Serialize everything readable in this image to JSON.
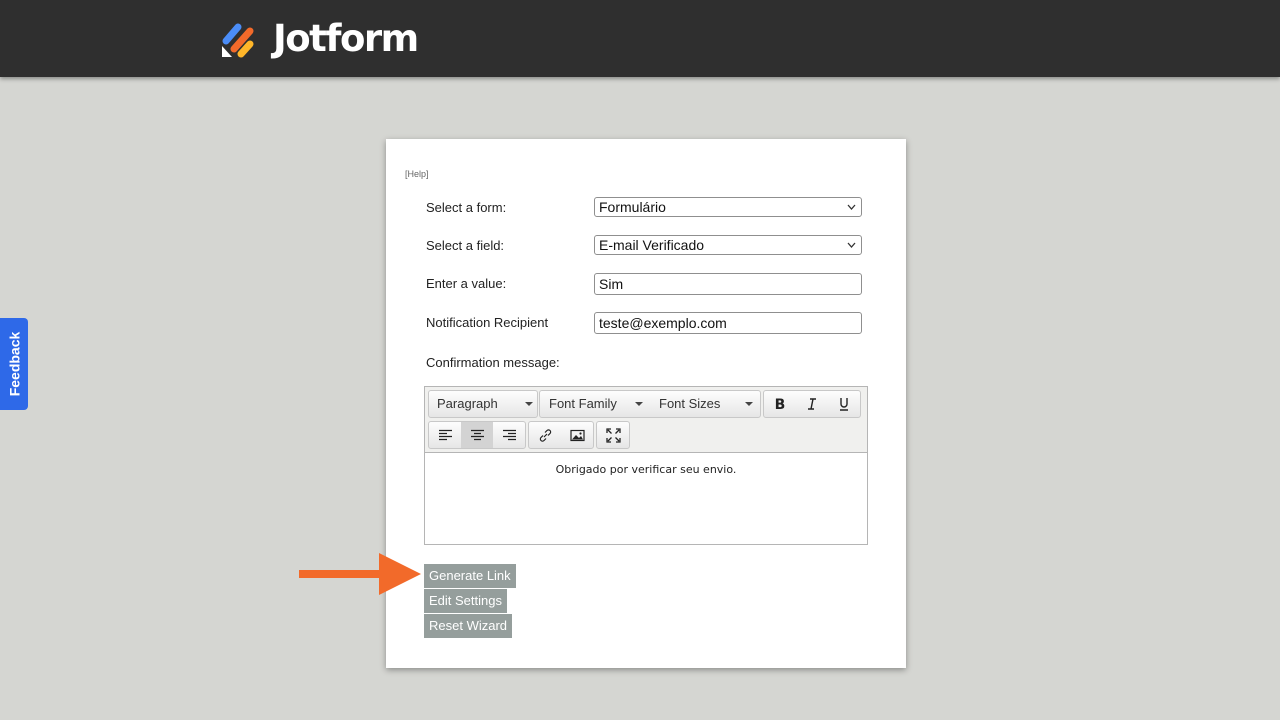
{
  "brand": {
    "name": "Jotform"
  },
  "feedback": {
    "label": "Feedback"
  },
  "panel": {
    "help_link": "[Help]",
    "form_label": "Select a form:",
    "form_value": "Formulário",
    "field_label": "Select a field:",
    "field_value": "E-mail Verificado",
    "value_label": "Enter a value:",
    "value_value": "Sim",
    "recipient_label": "Notification Recipient",
    "recipient_value": "teste@exemplo.com",
    "confirmation_label": "Confirmation message:"
  },
  "editor": {
    "format_dropdown": "Paragraph",
    "font_family_dropdown": "Font Family",
    "font_size_dropdown": "Font Sizes",
    "content": "Obrigado por verificar seu envio.",
    "active_alignment": "center"
  },
  "buttons": {
    "generate": "Generate Link",
    "edit": "Edit Settings",
    "reset": "Reset Wizard"
  },
  "colors": {
    "header_bg": "#2f2f2f",
    "page_bg": "#d5d6d2",
    "feedback_bg": "#2e69e8",
    "button_bg": "#959e9c",
    "arrow": "#f26a2a"
  }
}
